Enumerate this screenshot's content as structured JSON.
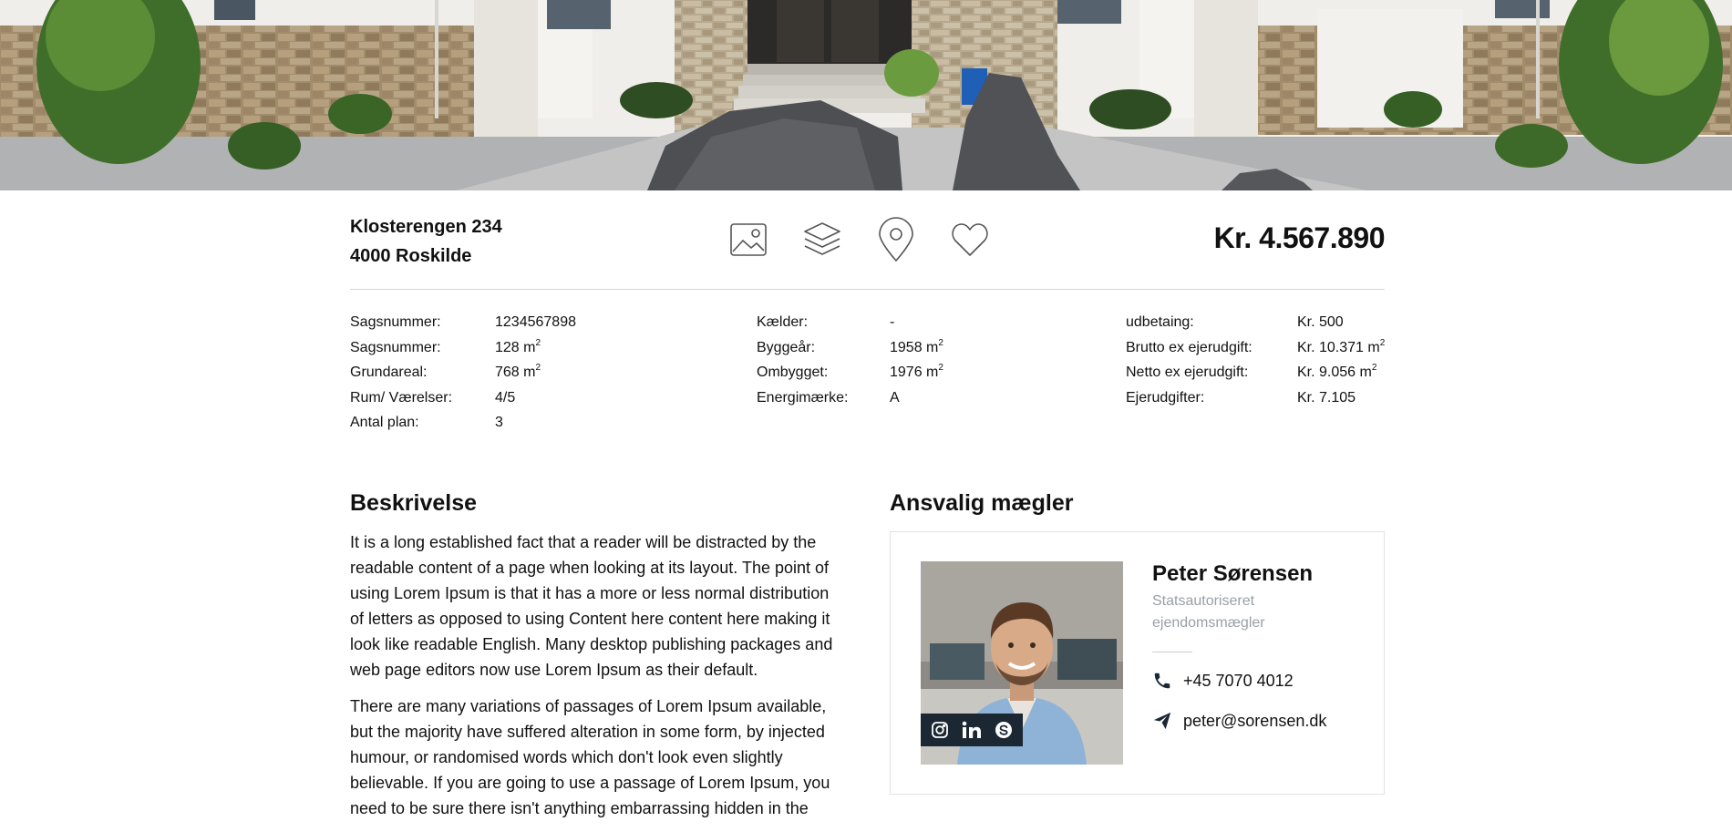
{
  "property": {
    "street": "Klosterengen 234",
    "city": "4000 Roskilde",
    "price": "Kr. 4.567.890"
  },
  "icons": [
    "image-icon",
    "layers-icon",
    "map-pin-icon",
    "heart-icon"
  ],
  "facts": {
    "col1": [
      {
        "label": "Sagsnummer:",
        "value": "1234567898"
      },
      {
        "label": "Sagsnummer:",
        "value": "128 m",
        "sup": "2"
      },
      {
        "label": "Grundareal:",
        "value": "768 m",
        "sup": "2"
      },
      {
        "label": "Rum/ Værelser:",
        "value": "4/5"
      },
      {
        "label": "Antal plan:",
        "value": "3"
      }
    ],
    "col2": [
      {
        "label": "Kælder:",
        "value": "-"
      },
      {
        "label": "Byggeår:",
        "value": "1958 m",
        "sup": "2"
      },
      {
        "label": "Ombygget:",
        "value": "1976 m",
        "sup": "2"
      },
      {
        "label": "Energimærke:",
        "value": "A"
      }
    ],
    "col3": [
      {
        "label": "udbetaing:",
        "value": "Kr. 500"
      },
      {
        "label": "Brutto ex ejerudgift:",
        "value": "Kr. 10.371 m",
        "sup": "2"
      },
      {
        "label": "Netto ex ejerudgift:",
        "value": "Kr. 9.056 m",
        "sup": "2"
      },
      {
        "label": "Ejerudgifter:",
        "value": "Kr. 7.105"
      }
    ]
  },
  "description": {
    "heading": "Beskrivelse",
    "paragraphs": [
      "It is a long established fact that a reader will be distracted by the readable content of a page when looking at its layout. The point of using Lorem Ipsum is that it has a more or less normal distribution of letters as opposed to using Content here content here making it look like readable English. Many desktop publishing packages and web page editors now use Lorem Ipsum as their default.",
      "There are many variations of passages of Lorem Ipsum available, but the majority have suffered alteration in some form, by injected humour, or randomised words which don't look even slightly believable. If you are going to use a passage of Lorem Ipsum, you need to be sure there isn't anything embarrassing hidden in the"
    ]
  },
  "agent": {
    "heading": "Ansvalig mægler",
    "name": "Peter Sørensen",
    "title": "Statsautoriseret ejendomsmægler",
    "phone": "+45 7070 4012",
    "email": "peter@sorensen.dk",
    "social": [
      "instagram-icon",
      "linkedin-icon",
      "skype-icon"
    ]
  },
  "colors": {
    "text": "#111111",
    "muted": "#9aa0a6",
    "social_bar": "#1b2733",
    "icon_stroke": "#555555"
  }
}
